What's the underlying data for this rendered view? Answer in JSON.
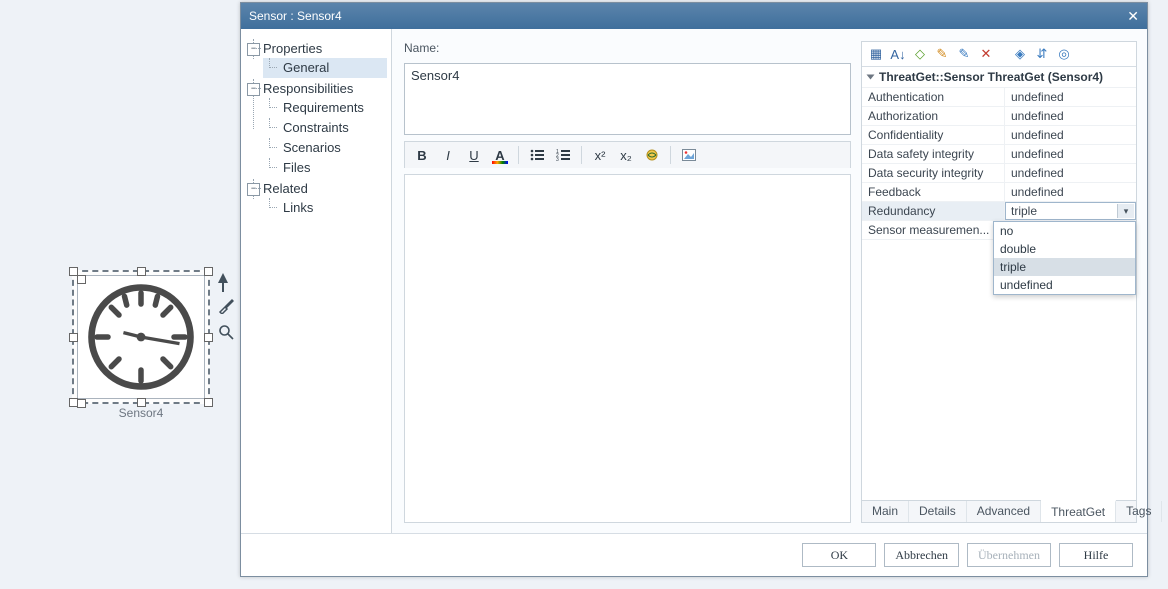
{
  "canvas": {
    "node_label": "Sensor4"
  },
  "window": {
    "title": "Sensor : Sensor4",
    "close_glyph": "✕"
  },
  "tree": {
    "properties": "Properties",
    "general": "General",
    "responsibilities": "Responsibilities",
    "requirements": "Requirements",
    "constraints": "Constraints",
    "scenarios": "Scenarios",
    "files": "Files",
    "related": "Related",
    "links": "Links"
  },
  "editor": {
    "name_label": "Name:",
    "name_value": "Sensor4",
    "tb": {
      "bold": "B",
      "italic": "I",
      "underline": "U",
      "color": "A",
      "bullets": "•≡",
      "numbers": "1≡",
      "sup": "x²",
      "sub": "x₂",
      "link": "🔗",
      "image": "🖼"
    }
  },
  "props": {
    "category": "ThreatGet::Sensor ThreatGet (Sensor4)",
    "rows": [
      {
        "k": "Authentication",
        "v": "undefined"
      },
      {
        "k": "Authorization",
        "v": "undefined"
      },
      {
        "k": "Confidentiality",
        "v": "undefined"
      },
      {
        "k": "Data safety integrity",
        "v": "undefined"
      },
      {
        "k": "Data security integrity",
        "v": "undefined"
      },
      {
        "k": "Feedback",
        "v": "undefined"
      },
      {
        "k": "Redundancy",
        "v": "triple"
      },
      {
        "k": "Sensor measuremen...",
        "v": ""
      }
    ],
    "dropdown": [
      "no",
      "double",
      "triple",
      "undefined"
    ],
    "tabs": [
      "Main",
      "Details",
      "Advanced",
      "ThreatGet",
      "Tags"
    ],
    "active_tab": "ThreatGet",
    "toolbar_icons": {
      "cat": "▦",
      "sort": "A↓",
      "tag": "◇",
      "edit": "✎",
      "note": "✎",
      "del": "✕",
      "label": "◈",
      "struct": "⇵",
      "target": "◎"
    }
  },
  "buttons": {
    "ok": "OK",
    "cancel": "Abbrechen",
    "apply": "Übernehmen",
    "help": "Hilfe"
  }
}
